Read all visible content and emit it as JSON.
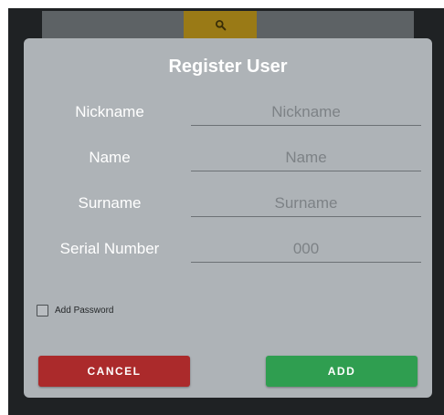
{
  "toolbar": {
    "search_icon": "search-icon"
  },
  "dialog": {
    "title": "Register User",
    "fields": [
      {
        "label": "Nickname",
        "placeholder": "Nickname"
      },
      {
        "label": "Name",
        "placeholder": "Name"
      },
      {
        "label": "Surname",
        "placeholder": "Surname"
      },
      {
        "label": "Serial Number",
        "placeholder": "000"
      }
    ],
    "add_password_label": "Add Password",
    "cancel_label": "CANCEL",
    "add_label": "ADD"
  },
  "colors": {
    "dialog_bg": "#aeb3b7",
    "cancel": "#ab2a2b",
    "add": "#2f9e50",
    "search_accent": "#9a7a16"
  }
}
